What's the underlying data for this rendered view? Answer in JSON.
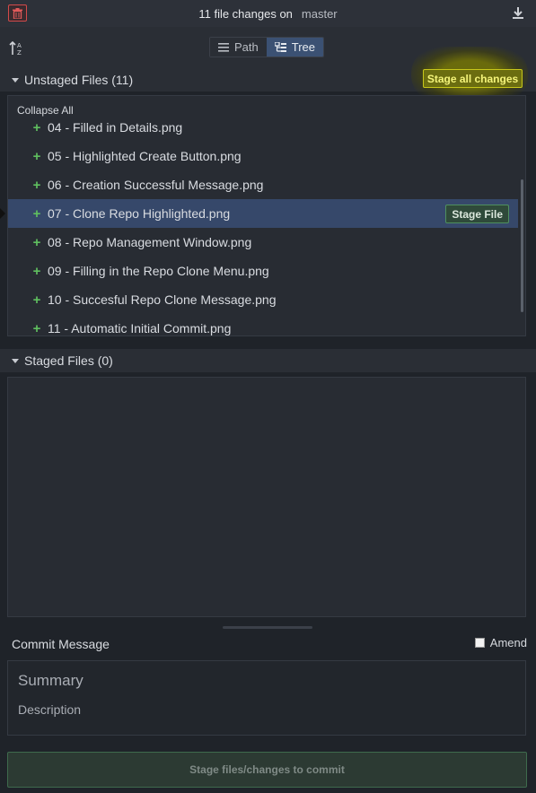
{
  "header": {
    "title": "11 file changes on",
    "branch": "master"
  },
  "toolbar": {
    "view_options": [
      {
        "label": "Path",
        "active": false
      },
      {
        "label": "Tree",
        "active": true
      }
    ]
  },
  "unstaged": {
    "title": "Unstaged Files (11)",
    "stage_all_label": "Stage all changes",
    "collapse_all_label": "Collapse All",
    "stage_file_label": "Stage File",
    "files": [
      {
        "name": "04 - Filled in Details.png"
      },
      {
        "name": "05 - Highlighted Create Button.png"
      },
      {
        "name": "06 - Creation Successful Message.png"
      },
      {
        "name": "07 - Clone Repo Highlighted.png",
        "selected": true
      },
      {
        "name": "08 - Repo Management Window.png"
      },
      {
        "name": "09 - Filling in the Repo Clone Menu.png"
      },
      {
        "name": "10 - Succesful Repo Clone Message.png"
      },
      {
        "name": "11 - Automatic Initial Commit.png"
      }
    ]
  },
  "staged": {
    "title": "Staged Files (0)"
  },
  "commit": {
    "label": "Commit Message",
    "amend_label": "Amend",
    "amend_checked": false,
    "summary_placeholder": "Summary",
    "description_placeholder": "Description",
    "commit_button_label": "Stage files/changes to commit"
  },
  "colors": {
    "accent_highlight": "#6b6d10",
    "added_green": "#5fbf5f",
    "selected_row": "#36486a",
    "delete_red": "#d34a4a"
  },
  "icons": [
    "trash-icon",
    "download-icon",
    "sort-icon",
    "list-icon",
    "tree-icon",
    "caret-down-icon",
    "plus-icon"
  ]
}
